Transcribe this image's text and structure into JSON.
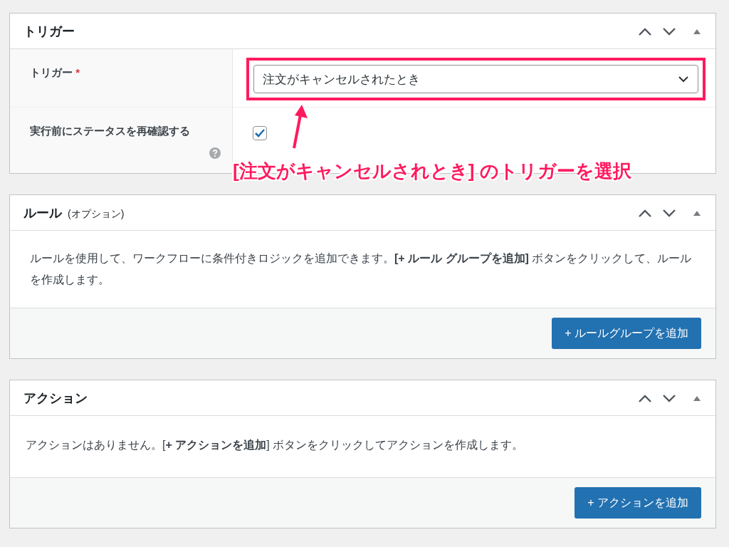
{
  "panels": [
    {
      "kind": "fields",
      "title": "トリガー",
      "fields": [
        {
          "kind": "select",
          "label": "トリガー",
          "required_mark": "*",
          "value": "注文がキャンセルされたとき",
          "highlighted": true
        },
        {
          "kind": "checkbox",
          "label": "実行前にステータスを再確認する",
          "checked": true,
          "help": true
        }
      ]
    },
    {
      "kind": "info",
      "title": "ルール",
      "subtitle": "(オプション)",
      "description": "ルールを使用して、ワークフローに条件付きロジックを追加できます。**[+ ルール グループを追加]** ボタンをクリックして、ルールを作成します。",
      "button": "+ ルールグループを追加"
    },
    {
      "kind": "info",
      "title": "アクション",
      "description": "アクションはありません。[**+ アクションを追加**] ボタンをクリックしてアクションを作成します。",
      "button": "+ アクションを追加"
    }
  ],
  "annotation": {
    "text": "[注文がキャンセルされとき] のトリガーを選択"
  }
}
